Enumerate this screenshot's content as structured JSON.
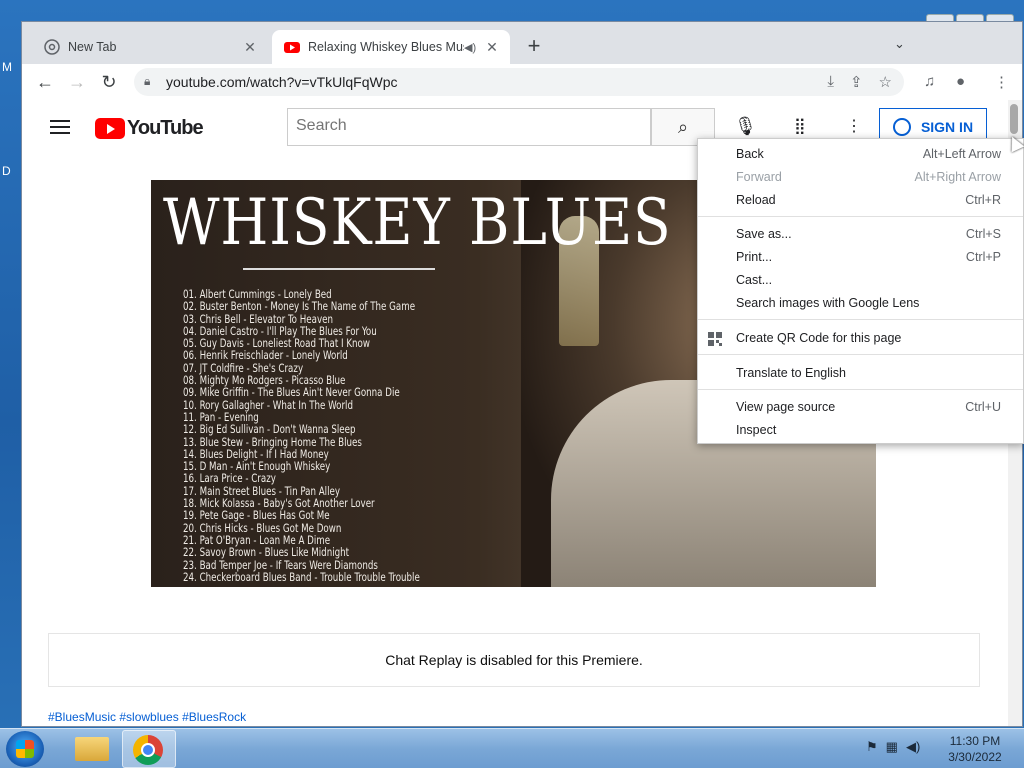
{
  "desktop": {
    "left_letters": [
      "M",
      "D"
    ]
  },
  "tabs": [
    {
      "title": "New Tab",
      "active": false
    },
    {
      "title": "Relaxing Whiskey Blues Music",
      "active": true
    }
  ],
  "toolbar": {
    "url": "youtube.com/watch?v=vTkUlqFqWpc"
  },
  "youtube": {
    "logo_text": "YouTube",
    "search_placeholder": "Search",
    "sign_in": "SIGN IN"
  },
  "video": {
    "title": "WHISKEY BLUES",
    "tracklist": [
      "01. Albert Cummings - Lonely Bed",
      "02. Buster Benton - Money Is The Name of The Game",
      "03. Chris Bell - Elevator To Heaven",
      "04. Daniel Castro - I'll Play The Blues For You",
      "05. Guy Davis - Loneliest Road That I Know",
      "06. Henrik Freischlader - Lonely World",
      "07. JT Coldfire - She's Crazy",
      "08. Mighty Mo Rodgers - Picasso Blue",
      "09. Mike Griffin - The Blues Ain't Never Gonna Die",
      "10. Rory Gallagher - What In The World",
      "11. Pan - Evening",
      "12. Big Ed Sullivan - Don't Wanna Sleep",
      "13. Blue Stew - Bringing Home The Blues",
      "14. Blues Delight - If I Had Money",
      "15. D Man - Ain't Enough Whiskey",
      "16. Lara Price - Crazy",
      "17. Main Street Blues - Tin Pan Alley",
      "18. Mick Kolassa - Baby's Got Another Lover",
      "19. Pete Gage - Blues Has Got Me",
      "20. Chris Hicks - Blues Got Me Down",
      "21. Pat O'Bryan - Loan Me A Dime",
      "22. Savoy Brown - Blues Like Midnight",
      "23. Bad Temper Joe - If Tears Were Diamonds",
      "24. Checkerboard Blues Band - Trouble Trouble Trouble"
    ]
  },
  "chat_replay": "Chat Replay is disabled for this Premiere.",
  "hashtags": "#BluesMusic #slowblues #BluesRock",
  "context_menu": {
    "items": [
      {
        "label": "Back",
        "shortcut": "Alt+Left Arrow",
        "disabled": false
      },
      {
        "label": "Forward",
        "shortcut": "Alt+Right Arrow",
        "disabled": true
      },
      {
        "label": "Reload",
        "shortcut": "Ctrl+R",
        "disabled": false
      },
      {
        "label": "Save as...",
        "shortcut": "Ctrl+S",
        "disabled": false
      },
      {
        "label": "Print...",
        "shortcut": "Ctrl+P",
        "disabled": false
      },
      {
        "label": "Cast...",
        "shortcut": "",
        "disabled": false
      },
      {
        "label": "Search images with Google Lens",
        "shortcut": "",
        "disabled": false
      },
      {
        "label": "Create QR Code for this page",
        "shortcut": "",
        "disabled": false
      },
      {
        "label": "Translate to English",
        "shortcut": "",
        "disabled": false
      },
      {
        "label": "View page source",
        "shortcut": "Ctrl+U",
        "disabled": false
      },
      {
        "label": "Inspect",
        "shortcut": "",
        "disabled": false
      }
    ]
  },
  "taskbar": {
    "time": "11:30 PM",
    "date": "3/30/2022"
  },
  "colors": {
    "youtube_red": "#ff0000",
    "link_blue": "#065fd4"
  }
}
